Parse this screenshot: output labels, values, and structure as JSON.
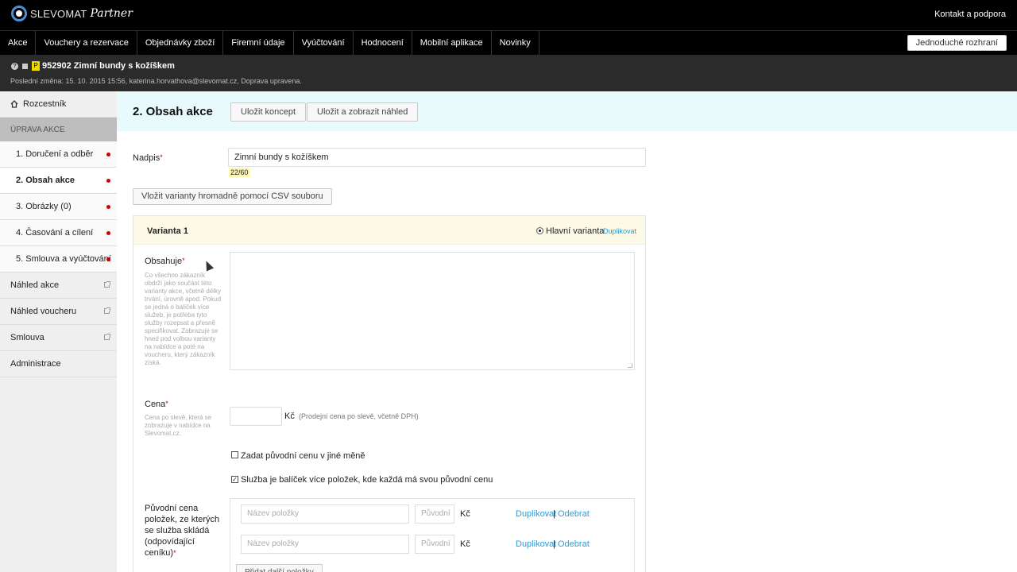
{
  "brand": {
    "name": "SLEVOMAT",
    "suffix": "Partner"
  },
  "top": {
    "contact": "Kontakt a podpora"
  },
  "nav": {
    "items": [
      "Akce",
      "Vouchery a rezervace",
      "Objednávky zboží",
      "Firemní údaje",
      "Vyúčtování",
      "Hodnocení",
      "Mobilní aplikace",
      "Novinky"
    ],
    "simple_ui": "Jednoduché rozhraní"
  },
  "deal": {
    "badge": "P",
    "title": "952902 Zimní bundy s kožíškem",
    "meta": "Poslední změna: 15. 10. 2015 15:56, katerina.horvathova@slevomat.cz, Doprava upravena."
  },
  "sidebar": {
    "home": "Rozcestník",
    "section": "ÚPRAVA AKCE",
    "steps": [
      "1. Doručení a odběr",
      "2. Obsah akce",
      "3. Obrázky (0)",
      "4. Časování a cílení",
      "5. Smlouva a vyúčtování"
    ],
    "links": [
      "Náhled akce",
      "Náhled voucheru",
      "Smlouva",
      "Administrace"
    ]
  },
  "main": {
    "title": "2. Obsah akce",
    "save_draft": "Uložit koncept",
    "save_preview": "Uložit a zobrazit náhled",
    "headline_label": "Nadpis",
    "required_mark": "*",
    "headline_value": "Zimní bundy s kožíškem",
    "counter": "22/60",
    "csv_button": "Vložit varianty hromadně pomocí CSV souboru"
  },
  "variant": {
    "title": "Varianta 1",
    "main_label": "Hlavní varianta",
    "duplicate": "Duplikovat",
    "contains_label": "Obsahuje",
    "contains_help": "Co všechno zákazník obdrží jako součást této varianty akce, včetně délky trvání, úrovně apod. Pokud se jedná o balíček více služeb, je potřeba tyto služby rozepsat a přesně specifikovat. Zobrazuje se hned pod volbou varianty na nabídce a poté na voucheru, který zákazník získá.",
    "price_label": "Cena",
    "price_help": "Cena po slevě, která se zobrazuje v nabídce na Slevomat.cz.",
    "currency": "Kč",
    "price_note": "(Prodejní cena po slevě, včetně DPH)",
    "other_currency": "Zadat původní cenu v jiné měně",
    "package_check": "Služba je balíček více položek, kde každá má svou původní cenu",
    "items_label": "Původní cena položek, ze kterých se služba skládá (odpovídající ceníku)",
    "item_name_placeholder": "Název položky",
    "item_price_placeholder": "Původní",
    "item_duplicate": "Duplikovat",
    "item_separator": "|",
    "item_remove": "Odebrat",
    "add_item": "Přidat další položky"
  }
}
